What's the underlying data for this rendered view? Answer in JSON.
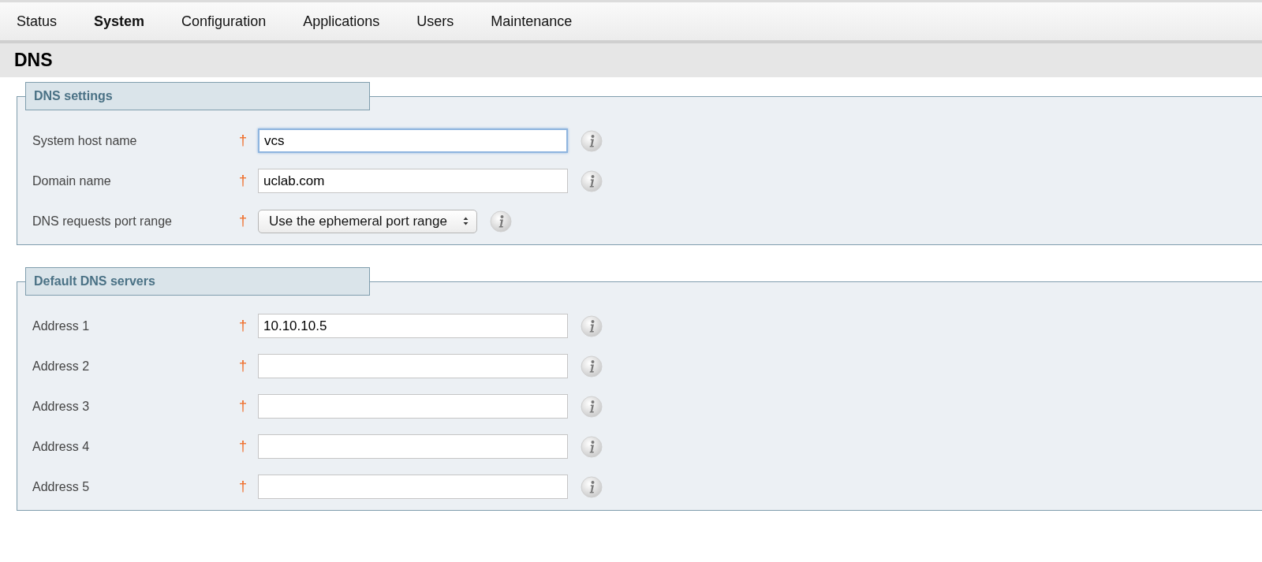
{
  "tabs": [
    {
      "label": "Status",
      "selected": false
    },
    {
      "label": "System",
      "selected": true
    },
    {
      "label": "Configuration",
      "selected": false
    },
    {
      "label": "Applications",
      "selected": false
    },
    {
      "label": "Users",
      "selected": false
    },
    {
      "label": "Maintenance",
      "selected": false
    }
  ],
  "page_title": "DNS",
  "sections": [
    {
      "title": "DNS settings",
      "fields": [
        {
          "kind": "text",
          "label": "System host name",
          "required_mark": "†",
          "value": "vcs",
          "focused": true
        },
        {
          "kind": "text",
          "label": "Domain name",
          "required_mark": "†",
          "value": "uclab.com",
          "focused": false
        },
        {
          "kind": "select",
          "label": "DNS requests port range",
          "required_mark": "†",
          "value": "Use the ephemeral port range"
        }
      ]
    },
    {
      "title": "Default DNS servers",
      "fields": [
        {
          "kind": "text",
          "label": "Address 1",
          "required_mark": "†",
          "value": "10.10.10.5",
          "focused": false
        },
        {
          "kind": "text",
          "label": "Address 2",
          "required_mark": "†",
          "focused": false
        },
        {
          "kind": "text",
          "label": "Address 3",
          "required_mark": "†",
          "focused": false
        },
        {
          "kind": "text",
          "label": "Address 4",
          "required_mark": "†",
          "focused": false
        },
        {
          "kind": "text",
          "label": "Address 5",
          "required_mark": "†",
          "focused": false
        }
      ]
    }
  ]
}
